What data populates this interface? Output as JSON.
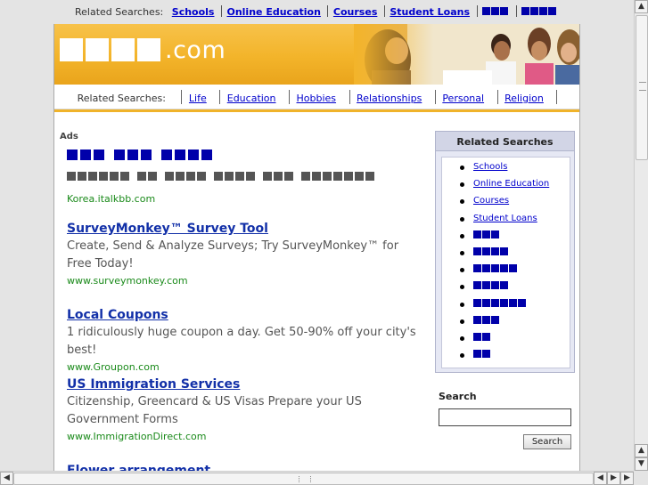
{
  "top_bar": {
    "label": "Related Searches:",
    "links": [
      "Schools",
      "Online Education",
      "Courses",
      "Student Loans"
    ],
    "masked_links": [
      3,
      4
    ]
  },
  "header": {
    "logo_blocks": 4,
    "logo_domain": ".com"
  },
  "nav": {
    "label": "Related Searches:",
    "links": [
      "Life",
      "Education",
      "Hobbies",
      "Relationships",
      "Personal",
      "Religion"
    ]
  },
  "ads": {
    "label": "Ads",
    "items": [
      {
        "title": "",
        "title_blocks": [
          3,
          3,
          4
        ],
        "desc": "",
        "desc_blocks": [
          6,
          2,
          4,
          4,
          3,
          7
        ],
        "url": "Korea.italkbb.com"
      },
      {
        "title": "SurveyMonkey™ Survey Tool",
        "desc": "Create, Send & Analyze Surveys; Try SurveyMonkey™ for Free Today!",
        "url": "www.surveymonkey.com"
      },
      {
        "title": "Local Coupons",
        "desc": "1 ridiculously huge coupon a day. Get 50-90% off your city's best!",
        "url": "www.Groupon.com"
      },
      {
        "title": "US Immigration Services",
        "desc": "Citizenship, Greencard & US Visas Prepare your US Government Forms",
        "url": "www.ImmigrationDirect.com"
      },
      {
        "title": "Flower arrangement",
        "desc": "",
        "url": ""
      }
    ]
  },
  "related_box": {
    "title": "Related Searches",
    "items": [
      "Schools",
      "Online Education",
      "Courses",
      "Student Loans"
    ],
    "masked_items": [
      3,
      4,
      5,
      4,
      6,
      3,
      2,
      2
    ]
  },
  "search": {
    "label": "Search",
    "input_value": "",
    "button_label": "Search"
  },
  "colors": {
    "header_gold": "#f3b42a",
    "link_blue": "#0000cc",
    "ad_title": "#1230a8",
    "ad_url": "#1a8a1a"
  }
}
